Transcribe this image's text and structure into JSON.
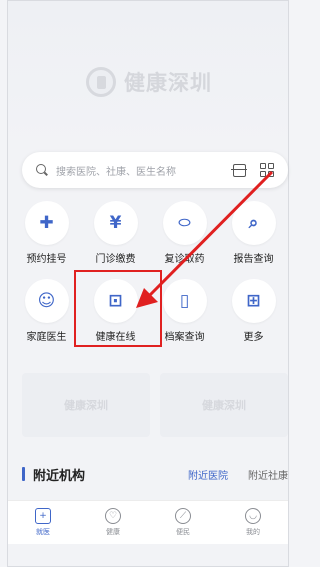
{
  "brand": {
    "name": "健康深圳"
  },
  "search": {
    "placeholder": "搜索医院、社康、医生名称"
  },
  "services": [
    {
      "label": "预约挂号",
      "icon": "plus-cross-icon",
      "glyph": "✚"
    },
    {
      "label": "门诊缴费",
      "icon": "yen-receipt-icon",
      "glyph": "¥"
    },
    {
      "label": "复诊取药",
      "icon": "pill-icon",
      "glyph": "⬭"
    },
    {
      "label": "报告查询",
      "icon": "report-search-icon",
      "glyph": "⌕"
    },
    {
      "label": "家庭医生",
      "icon": "doctor-icon",
      "glyph": "☺"
    },
    {
      "label": "健康在线",
      "icon": "online-consult-icon",
      "glyph": "⊡"
    },
    {
      "label": "档案查询",
      "icon": "folder-icon",
      "glyph": "▯"
    },
    {
      "label": "更多",
      "icon": "grid-more-icon",
      "glyph": "⊞"
    }
  ],
  "banners": [
    {
      "text": "健康深圳"
    },
    {
      "text": "健康深圳"
    }
  ],
  "nearby": {
    "title": "附近机构",
    "tabs": [
      "附近医院",
      "附近社康"
    ],
    "active_tab": 0
  },
  "bottom_nav": [
    {
      "label": "就医",
      "icon": "plus-square-icon",
      "glyph": "+"
    },
    {
      "label": "健康",
      "icon": "heart-icon",
      "glyph": "♡"
    },
    {
      "label": "便民",
      "icon": "compass-icon",
      "glyph": "⟋"
    },
    {
      "label": "我的",
      "icon": "smile-icon",
      "glyph": "◡"
    }
  ],
  "colors": {
    "accent": "#3f66c8",
    "highlight": "#e02020"
  }
}
